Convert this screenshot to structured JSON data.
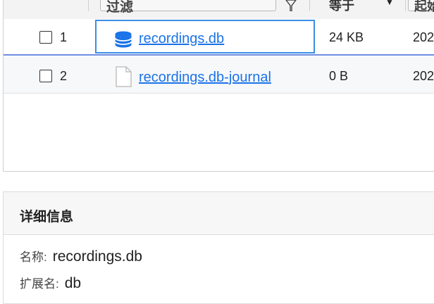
{
  "filter_bar": {
    "filter_placeholder": "过滤",
    "condition_label": "等于",
    "start_placeholder": "起始"
  },
  "rows": [
    {
      "index": "1",
      "name": "recordings.db",
      "size": "24 KB",
      "date": "202",
      "icon": "database-icon",
      "focused": true
    },
    {
      "index": "2",
      "name": "recordings.db-journal",
      "size": "0 B",
      "date": "202",
      "icon": "file-icon",
      "focused": false
    }
  ],
  "details": {
    "title": "详细信息",
    "name_label": "名称:",
    "name_value": "recordings.db",
    "ext_label": "扩展名:",
    "ext_value": "db"
  },
  "colors": {
    "accent": "#3a8ee6",
    "link": "#1a73e8",
    "divider": "#6e8de0"
  }
}
